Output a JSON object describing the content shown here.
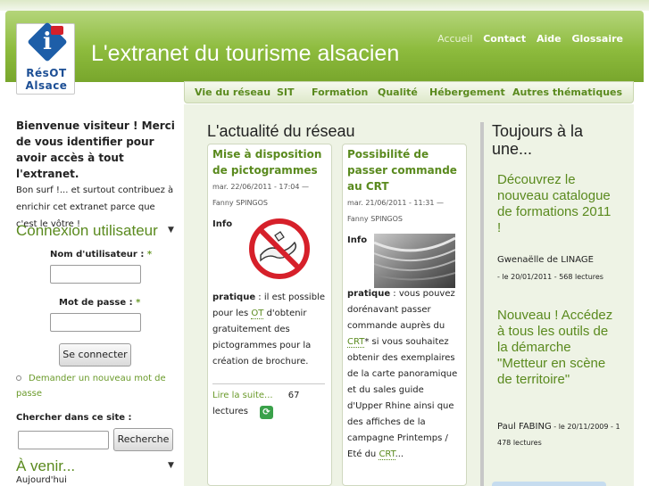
{
  "logo": {
    "line1": "RésOT",
    "line2": "Alsace"
  },
  "site_title": "L'extranet du tourisme alsacien",
  "top_nav": [
    "Accueil",
    "Contact",
    "Aide",
    "Glossaire"
  ],
  "main_nav": [
    "Vie du réseau",
    "SIT",
    "Formation",
    "Qualité",
    "Hébergement",
    "Autres thématiques"
  ],
  "sidebar": {
    "welcome": "Bienvenue visiteur ! Merci de vous identifier pour avoir accès à tout l'extranet.",
    "welcome_sub": "Bon surf !... et surtout contribuez à enrichir cet extranet parce que c'est le vôtre !",
    "login_heading": "Connexion utilisateur",
    "username_label": "Nom d'utilisateur :",
    "password_label": "Mot de passe :",
    "required_mark": "*",
    "login_button": "Se connecter",
    "forgot_link": "Demander un nouveau mot de passe",
    "search_label": "Chercher dans ce site :",
    "search_button": "Recherche",
    "upcoming_heading": "À venir...",
    "upcoming_first": "Aujourd'hui"
  },
  "news": {
    "heading": "L'actualité du réseau",
    "card1": {
      "title": "Mise à disposition de pictogrammes",
      "meta": "mar. 22/06/2011 - 17:04 — Fanny SPINGOS",
      "info": "Info",
      "text_bold": "pratique",
      "text_a": " : il est possible pour les ",
      "text_link": "OT",
      "text_b": " d'obtenir gratuitement des pictogrammes pour la création de brochure.",
      "read_more": "Lire la suite...",
      "reads_count": "67",
      "reads_word": "lectures"
    },
    "card2": {
      "title": "Possibilité de passer commande au CRT",
      "meta": "mar. 21/06/2011 - 11:31 — Fanny SPINGOS",
      "info": "Info",
      "text_bold": "pratique",
      "text_a": " : vous pouvez dorénavant passer commande auprès du ",
      "text_link": "CRT",
      "text_b": "* si vous souhaitez obtenir des exemplaires de la carte panoramique et du sales guide d'Upper Rhine ainsi que des affiches de la campagne Printemps / Eté du ",
      "text_link2": "CRT",
      "text_c": "..."
    }
  },
  "right": {
    "heading": "Toujours à la une...",
    "item1": {
      "title": "Découvrez le nouveau catalogue de formations 2011 !",
      "author": "Gwenaëlle de LINAGE",
      "meta": "- le 20/01/2011 - 568 lectures"
    },
    "item2": {
      "title": "Nouveau ! Accédez à tous les outils de la démarche \"Metteur en scène de territoire\"",
      "author": "Paul FABING",
      "meta": " - le 20/11/2009 - 1 478 lectures"
    }
  },
  "colors": {
    "header_green": "#8dbb3d",
    "link_green": "#5a8a1e",
    "logo_blue": "#1d5ea8",
    "logo_red": "#d4202a"
  }
}
